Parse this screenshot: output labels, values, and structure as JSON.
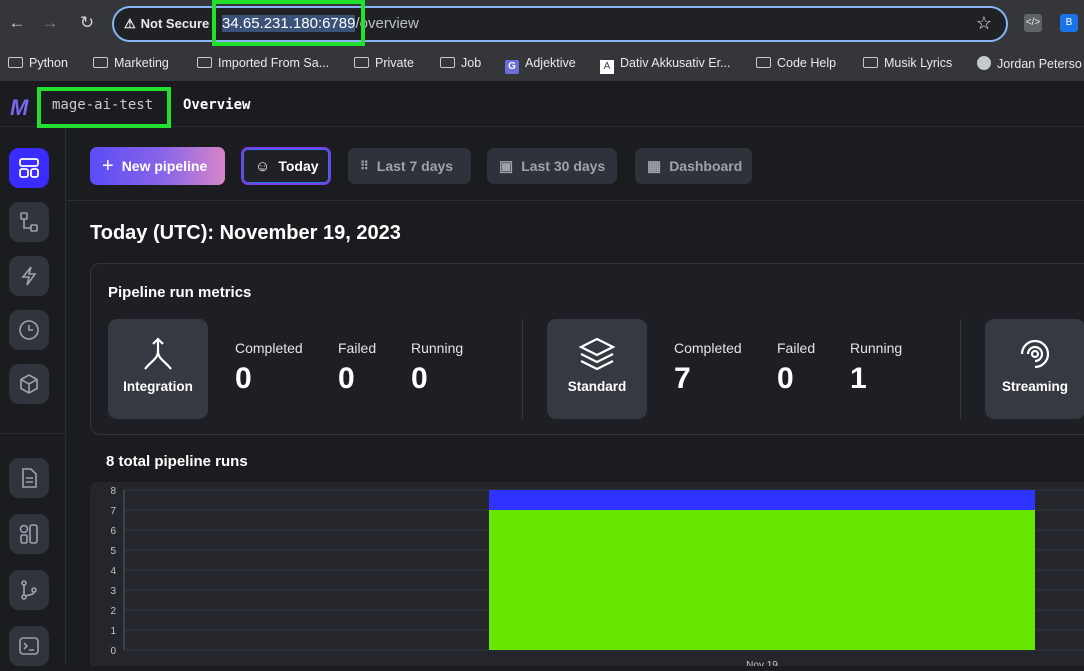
{
  "browser": {
    "security_label": "Not Secure",
    "url_host": "34.65.231.180:6789",
    "url_path": "/overview",
    "bookmarks": [
      "Python",
      "Marketing",
      "Imported From Sa...",
      "Private",
      "Job",
      "Adjektive",
      "Dativ Akkusativ Er...",
      "Code Help",
      "Musik Lyrics",
      "Jordan Peterso"
    ]
  },
  "app": {
    "project_name": "mage-ai-test",
    "breadcrumb_sep": "›",
    "page_title": "Overview"
  },
  "toolbar": {
    "new_pipeline": "New pipeline",
    "today": "Today",
    "last7": "Last 7 days",
    "last30": "Last 30 days",
    "dashboard": "Dashboard"
  },
  "main": {
    "date_title": "Today (UTC): November 19, 2023",
    "metrics_title": "Pipeline run metrics",
    "stat_labels": {
      "completed": "Completed",
      "failed": "Failed",
      "running": "Running"
    },
    "types": [
      {
        "label": "Integration",
        "completed": "0",
        "failed": "0",
        "running": "0"
      },
      {
        "label": "Standard",
        "completed": "7",
        "failed": "0",
        "running": "1"
      },
      {
        "label": "Streaming"
      }
    ],
    "runs_title": "8 total pipeline runs"
  },
  "chart_data": {
    "type": "bar",
    "stacked": true,
    "categories": [
      "Nov 19"
    ],
    "series": [
      {
        "values": [
          7
        ],
        "color": "#67e600"
      },
      {
        "values": [
          1
        ],
        "color": "#2f33ff"
      }
    ],
    "yticks": [
      "0",
      "1",
      "2",
      "3",
      "4",
      "5",
      "6",
      "7",
      "8"
    ],
    "ylim": [
      0,
      8
    ],
    "grid": true
  },
  "colors": {
    "accent": "#3a2bff",
    "success": "#67e600",
    "running": "#2f33ff",
    "highlight": "#21e12d"
  }
}
